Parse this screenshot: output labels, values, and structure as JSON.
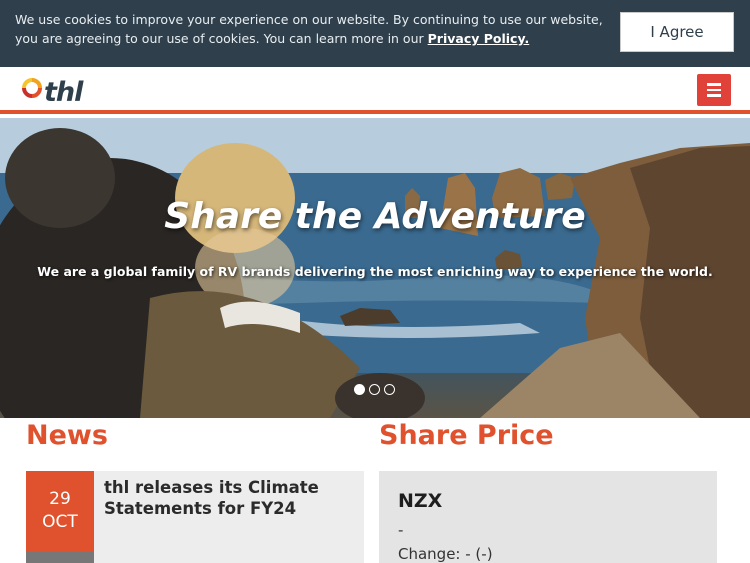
{
  "cookie": {
    "message": "We use cookies to improve your experience on our website. By continuing to use our website, you are agreeing to our use of cookies. You can learn more in our ",
    "link_label": "Privacy Policy.",
    "agree_label": "I Agree"
  },
  "header": {
    "logo_text": "thl",
    "menu_icon": "hamburger-menu-icon",
    "accent_color": "#e0522d",
    "menu_color": "#e0423a"
  },
  "hero": {
    "title": "Share the Adventure",
    "subtitle": "We are a global family of RV brands delivering the most enriching way to experience the world.",
    "slides_total": 3,
    "active_slide": 1
  },
  "news": {
    "heading": "News",
    "items": [
      {
        "day": "29",
        "month": "OCT",
        "headline": "thl releases its Climate Statements for FY24"
      }
    ]
  },
  "share_price": {
    "heading": "Share Price",
    "exchange": "NZX",
    "price": "-",
    "change": "Change: - (-)"
  }
}
